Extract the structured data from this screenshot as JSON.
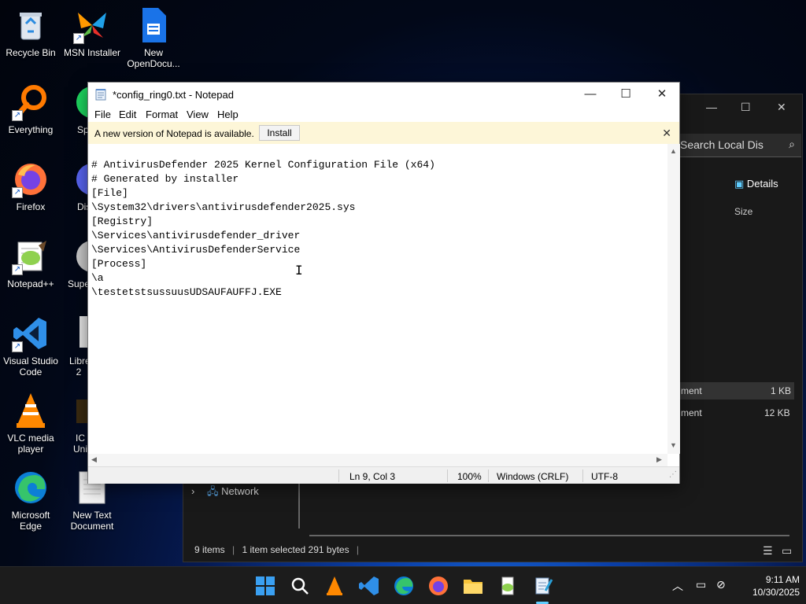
{
  "desktop": {
    "icons": [
      {
        "label": "Recycle Bin"
      },
      {
        "label": "MSN Installer"
      },
      {
        "label": "New OpenDocu..."
      },
      {
        "label": "Everything"
      },
      {
        "label": "Sp"
      },
      {
        "label": "Firefox"
      },
      {
        "label": "Dis"
      },
      {
        "label": "Notepad++"
      },
      {
        "label": "Supe"
      },
      {
        "label": "Visual Studio Code"
      },
      {
        "label": "Libre 2"
      },
      {
        "label": "VLC media player"
      },
      {
        "label": "IC Uni"
      },
      {
        "label": "Microsoft Edge"
      },
      {
        "label": "New Text Document"
      }
    ]
  },
  "explorer": {
    "search_placeholder": "Search Local Dis",
    "details_label": "Details",
    "column_size": "Size",
    "rows": [
      {
        "type_fragment": "ment",
        "size": "1 KB"
      },
      {
        "type_fragment": "ment",
        "size": "12 KB"
      }
    ],
    "nav_network": "Network",
    "status_items": "9 items",
    "status_selected": "1 item selected  291 bytes"
  },
  "notepad": {
    "title": "*config_ring0.txt - Notepad",
    "menu": [
      "File",
      "Edit",
      "Format",
      "View",
      "Help"
    ],
    "banner_message": "A new version of Notepad is available.",
    "banner_button": "Install",
    "content_lines": [
      "# AntivirusDefender 2025 Kernel Configuration File (x64)",
      "# Generated by installer",
      "[File]",
      "\\System32\\drivers\\antivirusdefender2025.sys",
      "[Registry]",
      "\\Services\\antivirusdefender_driver",
      "\\Services\\AntivirusDefenderService",
      "[Process]",
      "\\a",
      "\\testetstsussuusUDSAUFAUFFJ.EXE"
    ],
    "status": {
      "position": "Ln 9, Col 3",
      "zoom": "100%",
      "line_ending": "Windows (CRLF)",
      "encoding": "UTF-8"
    }
  },
  "taskbar": {
    "apps": [
      "start-icon",
      "search-icon",
      "vlc-icon",
      "vscode-icon",
      "edge-icon",
      "firefox-icon",
      "file-explorer-icon",
      "notepadpp-icon",
      "notepad-icon"
    ],
    "time": "9:11 AM",
    "date": "10/30/2025"
  }
}
